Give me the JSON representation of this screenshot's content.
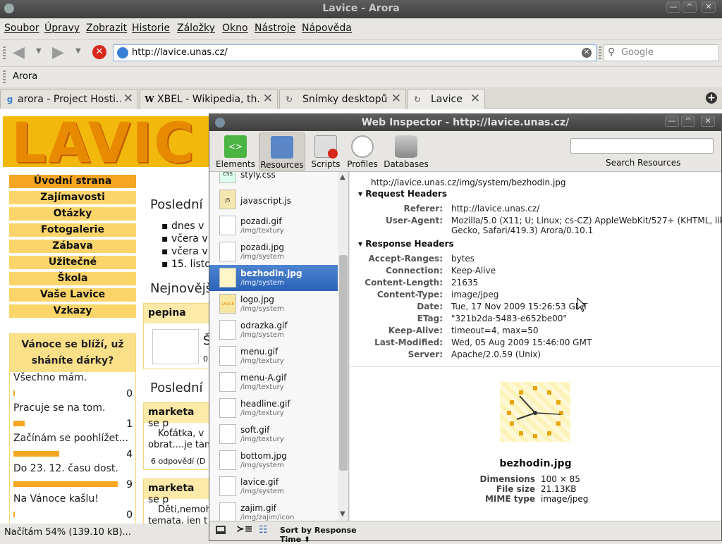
{
  "window": {
    "title": "Lavice - Arora"
  },
  "menu": [
    "Soubor",
    "Úpravy",
    "Zobrazit",
    "Historie",
    "Záložky",
    "Okno",
    "Nástroje",
    "Nápověda"
  ],
  "nav": {
    "url": "http://lavice.unas.cz/",
    "search_placeholder": "Google"
  },
  "bookmarks": {
    "item": "Arora"
  },
  "tabs": [
    {
      "label": "arora - Project Hosti...",
      "icon": "google-icon"
    },
    {
      "label": "XBEL - Wikipedia, th...",
      "icon": "wikipedia-icon"
    },
    {
      "label": "Snímky desktopů",
      "icon": "reload-icon"
    },
    {
      "label": "Lavice",
      "icon": "reload-icon"
    }
  ],
  "page": {
    "menu": [
      "Úvodní strana",
      "Zajímavosti",
      "Otázky",
      "Fotogalerie",
      "Zábava",
      "Užitečné",
      "Škola",
      "Vaše Lavice",
      "Vzkazy"
    ],
    "poll": {
      "title": "Vánoce se blíží, už sháníte dárky?",
      "options": [
        {
          "label": "Všechno mám.",
          "count": "0",
          "fill": 0.01
        },
        {
          "label": "Pracuje se na tom.",
          "count": "1",
          "fill": 0.11
        },
        {
          "label": "Začínám se poohlížet...",
          "count": "4",
          "fill": 0.44
        },
        {
          "label": "Do 23. 12. času dost.",
          "count": "9",
          "fill": 1.0
        },
        {
          "label": "Na Vánoce kašlu!",
          "count": "0",
          "fill": 0.01
        }
      ]
    },
    "h_posledni1": "Poslední",
    "list": [
      "dnes v",
      "včera v",
      "včera v",
      "15. listo"
    ],
    "h_nejnovejsi": "Nejnovějš",
    "box1": {
      "author": "pepina",
      "text": "Š",
      "num": "0"
    },
    "h_posledni2": "Poslední",
    "box2": {
      "author": "marketa",
      "suffix": "se p",
      "text1": "Koťátka, v",
      "text2": "obrat....je tam",
      "count": "6 odpovědí (D"
    },
    "box3": {
      "author": "marketa",
      "suffix": "se p",
      "text1": "Děti,nemoh",
      "text2": "temata, jen t"
    }
  },
  "status": "Načítám 54% (139.10 kB)...",
  "inspector": {
    "title": "Web Inspector - http://lavice.unas.cz/",
    "tools": [
      "Elements",
      "Resources",
      "Scripts",
      "Profiles",
      "Databases"
    ],
    "search_label": "Search Resources",
    "resources": [
      {
        "name": "styly.css",
        "path": "",
        "thumb": "CSS"
      },
      {
        "name": "javascript.js",
        "path": "",
        "thumb": "JS"
      },
      {
        "name": "pozadi.gif",
        "path": "/img/textury",
        "thumb": ""
      },
      {
        "name": "pozadi.jpg",
        "path": "/img/system",
        "thumb": ""
      },
      {
        "name": "bezhodin.jpg",
        "path": "/img/system",
        "thumb": ""
      },
      {
        "name": "logo.jpg",
        "path": "/img/system",
        "thumb": "LAVICE"
      },
      {
        "name": "odrazka.gif",
        "path": "/img/system",
        "thumb": ""
      },
      {
        "name": "menu.gif",
        "path": "/img/textury",
        "thumb": ""
      },
      {
        "name": "menu-A.gif",
        "path": "/img/textury",
        "thumb": ""
      },
      {
        "name": "headline.gif",
        "path": "/img/textury",
        "thumb": ""
      },
      {
        "name": "soft.gif",
        "path": "/img/textury",
        "thumb": ""
      },
      {
        "name": "bottom.jpg",
        "path": "/img/system",
        "thumb": ""
      },
      {
        "name": "lavice.gif",
        "path": "/img/system",
        "thumb": ""
      },
      {
        "name": "zajim.gif",
        "path": "/img/zajim/icon",
        "thumb": ""
      }
    ],
    "url": "http://lavice.unas.cz/img/system/bezhodin.jpg",
    "request_title": "Request Headers",
    "request": [
      {
        "k": "Referer:",
        "v": "http://lavice.unas.cz/"
      },
      {
        "k": "User-Agent:",
        "v": "Mozilla/5.0 (X11; U; Linux; cs-CZ) AppleWebKit/527+ (KHTML, like",
        "v2": "Gecko, Safari/419.3) Arora/0.10.1"
      }
    ],
    "response_title": "Response Headers",
    "response": [
      {
        "k": "Accept-Ranges:",
        "v": "bytes"
      },
      {
        "k": "Connection:",
        "v": "Keep-Alive"
      },
      {
        "k": "Content-Length:",
        "v": "21635"
      },
      {
        "k": "Content-Type:",
        "v": "image/jpeg"
      },
      {
        "k": "Date:",
        "v": "Tue, 17 Nov 2009 15:26:53 GMT"
      },
      {
        "k": "ETag:",
        "v": "\"321b2da-5483-e652be00\""
      },
      {
        "k": "Keep-Alive:",
        "v": "timeout=4, max=50"
      },
      {
        "k": "Last-Modified:",
        "v": "Wed, 05 Aug 2009 15:46:00 GMT"
      },
      {
        "k": "Server:",
        "v": "Apache/2.0.59 (Unix)"
      }
    ],
    "image": {
      "name": "bezhodin.jpg",
      "props": [
        {
          "k": "Dimensions",
          "v": "100 × 85"
        },
        {
          "k": "File size",
          "v": "21.13KB"
        },
        {
          "k": "MIME type",
          "v": "image/jpeg"
        }
      ]
    },
    "sort": "Sort by Response Time"
  }
}
